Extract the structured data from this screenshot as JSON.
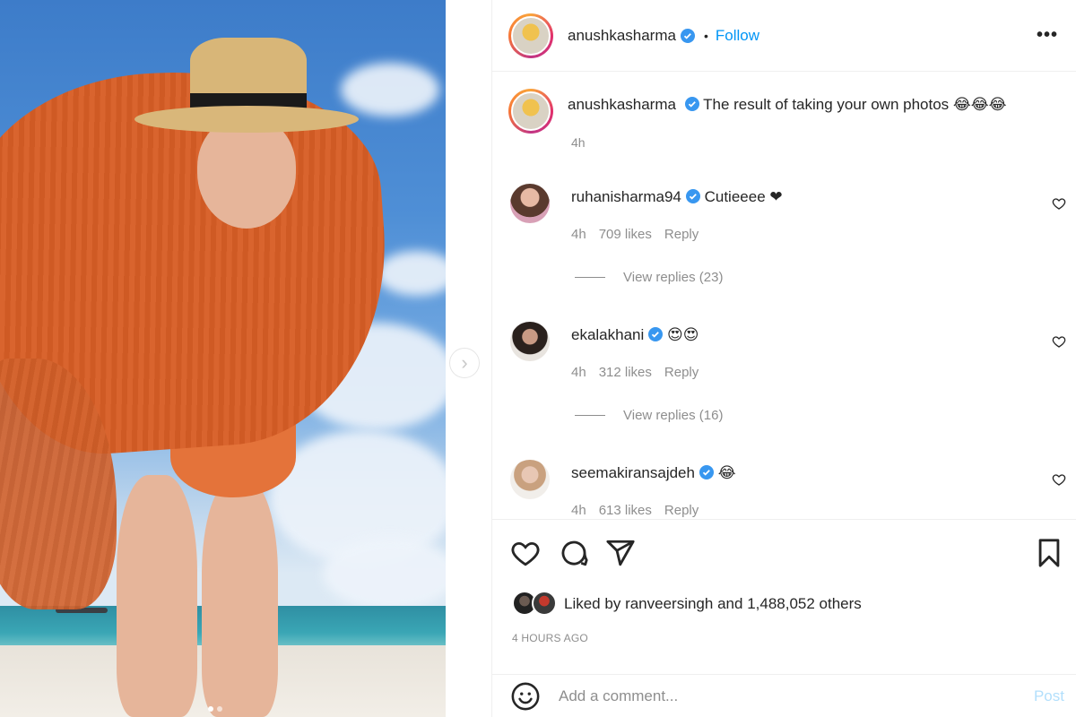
{
  "post": {
    "author": "anushkasharma",
    "follow_label": "Follow",
    "separator": "•",
    "more_icon": "more-horizontal-icon",
    "caption_text": "The result of taking your own photos 😂😂😂",
    "caption_time": "4h"
  },
  "comments": [
    {
      "username": "ruhanisharma94",
      "text": "Cutieeee ❤",
      "time": "4h",
      "likes": "709 likes",
      "reply": "Reply",
      "view_replies": "View replies (23)"
    },
    {
      "username": "ekalakhani",
      "text": "😍😍",
      "time": "4h",
      "likes": "312 likes",
      "reply": "Reply",
      "view_replies": "View replies (16)"
    },
    {
      "username": "seemakiransajdeh",
      "text": "😂",
      "time": "4h",
      "likes": "613 likes",
      "reply": "Reply"
    }
  ],
  "likes": {
    "prefix": "Liked by",
    "user": "ranveersingh",
    "joiner": "and",
    "others": "1,488,052 others"
  },
  "timestamp": "4 HOURS AGO",
  "add_comment": {
    "placeholder": "Add a comment...",
    "post_label": "Post"
  },
  "colors": {
    "accent": "#0095f6",
    "post_disabled": "#b2dffc",
    "verified": "#3897f0",
    "muted": "#8e8e8e"
  }
}
